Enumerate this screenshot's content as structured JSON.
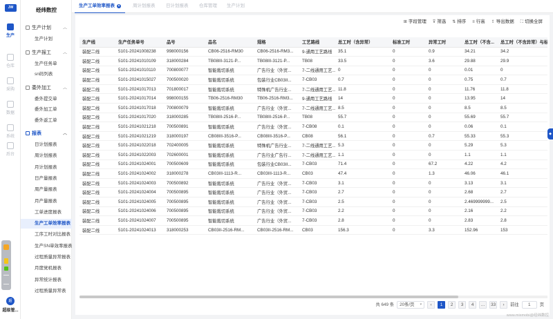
{
  "app": {
    "logo_text": "JW",
    "sidebar_title": "经纬数控",
    "user_name": "超级管...",
    "user_avatar": "超"
  },
  "rail": [
    {
      "label": "生产",
      "icon": "factory-icon",
      "active": true
    },
    {
      "label": "仓库",
      "icon": "warehouse-icon"
    },
    {
      "label": "采购",
      "icon": "purchase-icon"
    },
    {
      "label": "数据",
      "icon": "data-icon"
    },
    {
      "label": "系统",
      "icon": "system-icon"
    },
    {
      "label": "后台",
      "icon": "admin-icon"
    }
  ],
  "sidebar": {
    "groups": [
      {
        "label": "生产计划",
        "items": [
          "生产计划"
        ]
      },
      {
        "label": "生产报工",
        "items": [
          "生产任务单",
          "sn码列表"
        ]
      },
      {
        "label": "委外加工",
        "items": [
          "委外提交单",
          "委外加工单",
          "委外返工单"
        ]
      },
      {
        "label": "报表",
        "items": [
          "日计划报表",
          "周计划报表",
          "月计划报表",
          "日产量报表",
          "周产量报表",
          "月产量报表",
          "工单进度报表",
          "生产工单效率报表",
          "工序工时对比报表",
          "生产SN单效率报表",
          "过程质量异常报表",
          "月度党机报表",
          "异常统计报表",
          "过程质量异常表"
        ]
      }
    ]
  },
  "tabs": [
    {
      "label": "生产工单效率报表",
      "active": true
    },
    {
      "label": "周计划报表"
    },
    {
      "label": "日计划报表"
    },
    {
      "label": "仓库管理"
    },
    {
      "label": "生产计划"
    }
  ],
  "toolbar": [
    {
      "icon": "grid-icon",
      "label": "字段管理"
    },
    {
      "icon": "filter-icon",
      "label": "筛选"
    },
    {
      "icon": "sort-icon",
      "label": "排序"
    },
    {
      "icon": "row-height-icon",
      "label": "行高"
    },
    {
      "icon": "export-icon",
      "label": "导出数据"
    },
    {
      "icon": "fullscreen-icon",
      "label": "切换全屏"
    }
  ],
  "table": {
    "columns": [
      "生产线",
      "生产任务单号",
      "品号",
      "品名",
      "规格",
      "工艺路线",
      "总工时（含异常）",
      "标准工时",
      "异常工时",
      "总工时（不含...",
      "总工时（不含异常）与标准工时"
    ],
    "rows": [
      [
        "装配二线",
        "5101-20241008238",
        "998000156",
        "CB06-2516-RM30",
        "CB06-2516-RM3...",
        "9-通用工艺路线",
        "35.1",
        "0",
        "0.9",
        "34.21",
        "34.2"
      ],
      [
        "装配二线",
        "5101-20241010109",
        "318000284",
        "TB08III-3121-P...",
        "TB08III-3121-P...",
        "TB08",
        "33.5",
        "0",
        "3.6",
        "29.88",
        "29.9"
      ],
      [
        "装配二线",
        "5101-20241010110",
        "700800077",
        "智能裁切系统",
        "广告行业（外贸...",
        "7-二线通用工艺...",
        "0",
        "0",
        "0",
        "0.01",
        "0"
      ],
      [
        "装配二线",
        "5101-20241015027",
        "700500020",
        "智能裁切系统",
        "包装行业CB03II...",
        "7-CB03",
        "0.7",
        "0",
        "0",
        "0.75",
        "0.7"
      ],
      [
        "装配二线",
        "5101-20241017013",
        "701800017",
        "智能裁切系统",
        "特殊机广告行业...",
        "7-二线通用工艺...",
        "11.8",
        "0",
        "0",
        "11.76",
        "11.8"
      ],
      [
        "装配二线",
        "5101-20241017014",
        "998000155",
        "TB06-2516-RM30",
        "TB06-2516-RM3...",
        "9-通用工艺路线",
        "14",
        "0",
        "0",
        "13.95",
        "14"
      ],
      [
        "装配二线",
        "5101-20241017018",
        "700800079",
        "智能裁切系统",
        "广告行业（外贸...",
        "7-二线通用工艺...",
        "8.5",
        "0",
        "0",
        "8.5",
        "8.5"
      ],
      [
        "装配二线",
        "5101-20241017020",
        "318000285",
        "TB08III-2516-P...",
        "TB08III-2516-P...",
        "TB08",
        "55.7",
        "0",
        "0",
        "55.69",
        "55.7"
      ],
      [
        "装配二线",
        "5101-20241021218",
        "700500891",
        "智能裁切系统",
        "广告行业（外贸...",
        "7-CB08",
        "0.1",
        "0",
        "0",
        "0.06",
        "0.1"
      ],
      [
        "装配二线",
        "5101-20241021219",
        "318000197",
        "CB08III-3516-P...",
        "CB08III-3516-P...",
        "CB08",
        "56.1",
        "0",
        "0.7",
        "55.33",
        "55.3"
      ],
      [
        "装配二线",
        "5101-20241022018",
        "702400005",
        "智能裁切系统",
        "特殊机广告行业...",
        "7-二线通用工艺...",
        "5.3",
        "0",
        "0",
        "5.29",
        "5.3"
      ],
      [
        "装配二线",
        "5101-20241022003",
        "702600001",
        "智能裁切系统",
        "广告行业广告行...",
        "7-二线通用工艺...",
        "1.1",
        "0",
        "0",
        "1.1",
        "1.1"
      ],
      [
        "装配二线",
        "5101-20241024001",
        "700500609",
        "智能裁切系统",
        "包装行业CB03II...",
        "7-CB03",
        "71.4",
        "0",
        "67.2",
        "4.22",
        "4.2"
      ],
      [
        "装配二线",
        "5101-20241024002",
        "318000278",
        "CB03III-1113-R...",
        "CB03III-1113-R...",
        "CB03",
        "47.4",
        "0",
        "1.3",
        "46.06",
        "46.1"
      ],
      [
        "装配二线",
        "5101-20241024003",
        "700500892",
        "智能裁切系统",
        "广告行业（外贸...",
        "7-CB03",
        "3.1",
        "0",
        "0",
        "3.13",
        "3.1"
      ],
      [
        "装配二线",
        "5101-20241024004",
        "700500895",
        "智能裁切系统",
        "广告行业（外贸...",
        "7-CB03",
        "2.7",
        "0",
        "0",
        "2.68",
        "2.7"
      ],
      [
        "装配二线",
        "5101-20241024005",
        "700500895",
        "智能裁切系统",
        "广告行业（外贸...",
        "7-CB03",
        "2.5",
        "0",
        "0",
        "2.469999999...",
        "2.5"
      ],
      [
        "装配二线",
        "5101-20241024006",
        "700500895",
        "智能裁切系统",
        "广告行业（外贸...",
        "7-CB03",
        "2.2",
        "0",
        "0",
        "2.16",
        "2.2"
      ],
      [
        "装配二线",
        "5101-20241024007",
        "700500895",
        "智能裁切系统",
        "广告行业（外贸...",
        "7-CB03",
        "2.8",
        "0",
        "0",
        "2.83",
        "2.8"
      ],
      [
        "装配二线",
        "5101-20241024013",
        "318000253",
        "CB03II-2516-RM...",
        "CB03II-2516-RM...",
        "CB03",
        "156.3",
        "0",
        "3.3",
        "152.96",
        "153"
      ]
    ]
  },
  "pager": {
    "total": "共 649 条",
    "page_size": "20条/页",
    "prev": "‹",
    "pages": [
      "1",
      "2",
      "3",
      "4",
      "…",
      "33"
    ],
    "next": "›",
    "goto_label": "前往",
    "goto_value": "1",
    "goto_suffix": "页"
  },
  "watermark": "www.mixmobi@经纬数控"
}
